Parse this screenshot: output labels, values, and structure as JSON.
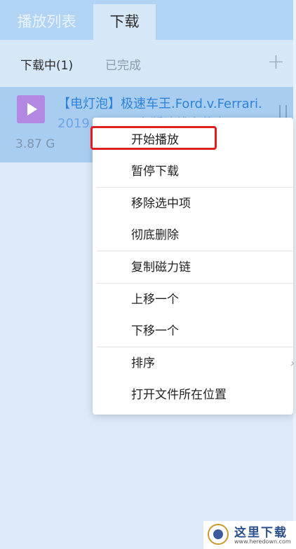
{
  "tabs": {
    "playlist": "播放列表",
    "download": "下载"
  },
  "subtabs": {
    "downloading": "下载中(1)",
    "completed": "已完成"
  },
  "item": {
    "title_line1": "【电灯泡】极速车王.Ford.v.Ferrari.",
    "title_line2": "2019.1080p.台版暗线字幕中...",
    "size": "3.87 G"
  },
  "context_menu": {
    "items": [
      "开始播放",
      "暂停下载",
      "移除选中项",
      "彻底删除",
      "复制磁力链",
      "上移一个",
      "下移一个",
      "排序",
      "打开文件所在位置"
    ]
  },
  "watermark": {
    "text": "这里下载",
    "url": "www.heredown.com"
  },
  "colors": {
    "highlight": "#e02020",
    "accent": "#2f82d6",
    "tabbar": "#b2d4f4"
  }
}
